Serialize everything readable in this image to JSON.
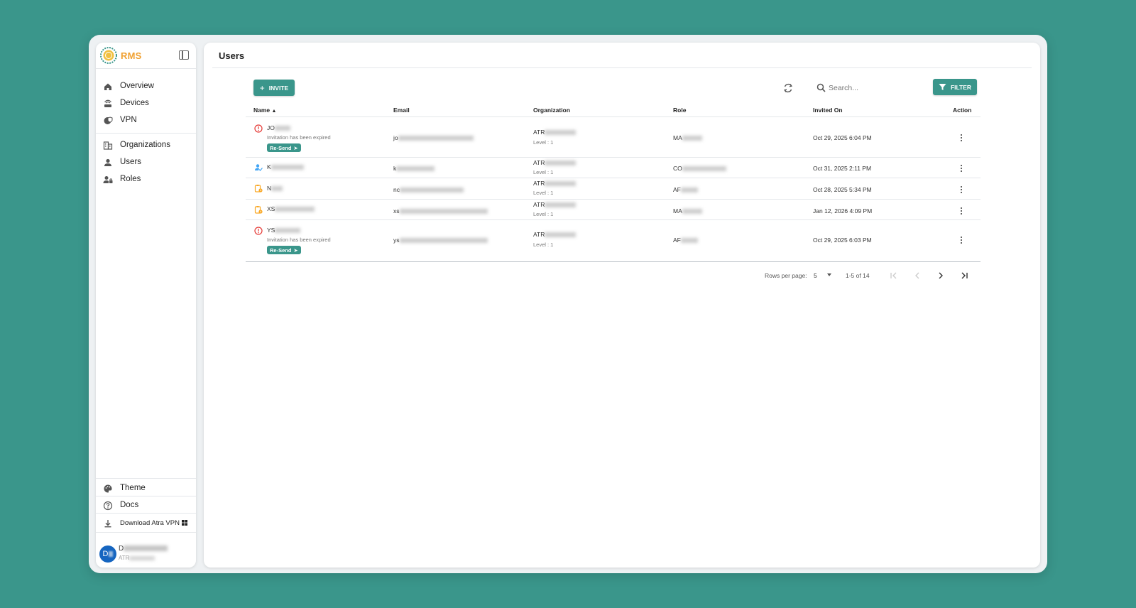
{
  "app": {
    "brand": "RMS"
  },
  "sidebar": {
    "items": [
      {
        "label": "Overview",
        "icon": "home-icon"
      },
      {
        "label": "Devices",
        "icon": "router-icon"
      },
      {
        "label": "VPN",
        "icon": "vpn-icon"
      },
      {
        "label": "Organizations",
        "icon": "building-icon"
      },
      {
        "label": "Users",
        "icon": "user-icon"
      },
      {
        "label": "Roles",
        "icon": "roles-icon"
      }
    ],
    "footer": {
      "theme_label": "Theme",
      "docs_label": "Docs",
      "download_label": "Download Atra VPN"
    },
    "user": {
      "initials": "D",
      "name": "D",
      "org": "ATR"
    }
  },
  "main": {
    "title": "Users",
    "invite_label": "INVITE",
    "search_placeholder": "Search...",
    "filter_label": "FILTER",
    "columns": {
      "name": "Name",
      "email": "Email",
      "organization": "Organization",
      "role": "Role",
      "invited_on": "Invited On",
      "action": "Action"
    },
    "rows": [
      {
        "status": "expired",
        "name": "JO",
        "note": "Invitation has been expired",
        "resend": "Re-Send",
        "email": "jo",
        "org": "ATR",
        "level": "Level : 1",
        "role": "MA",
        "invited": "Oct 29, 2025 6:04 PM"
      },
      {
        "status": "active",
        "name": "K",
        "email": "k",
        "org": "ATR",
        "level": "Level : 1",
        "role": "CO",
        "invited": "Oct 31, 2025 2:11 PM"
      },
      {
        "status": "pending",
        "name": "N",
        "email": "nc",
        "org": "ATR",
        "level": "Level : 1",
        "role": "AF",
        "invited": "Oct 28, 2025 5:34 PM"
      },
      {
        "status": "pending",
        "name": "XS",
        "email": "xs",
        "org": "ATR",
        "level": "Level : 1",
        "role": "MA",
        "invited": "Jan 12, 2026 4:09 PM"
      },
      {
        "status": "expired",
        "name": "YS",
        "note": "Invitation has been expired",
        "resend": "Re-Send",
        "email": "ys",
        "org": "ATR",
        "level": "Level : 1",
        "role": "AF",
        "invited": "Oct 29, 2025 6:03 PM"
      }
    ],
    "pagination": {
      "rows_per_page_label": "Rows per page:",
      "rows_per_page": "5",
      "range": "1-5 of 14"
    }
  },
  "colors": {
    "accent": "#3a968b",
    "brand": "#f0a030",
    "error": "#e53935",
    "warning": "#f9a825",
    "info": "#42a5f5"
  }
}
